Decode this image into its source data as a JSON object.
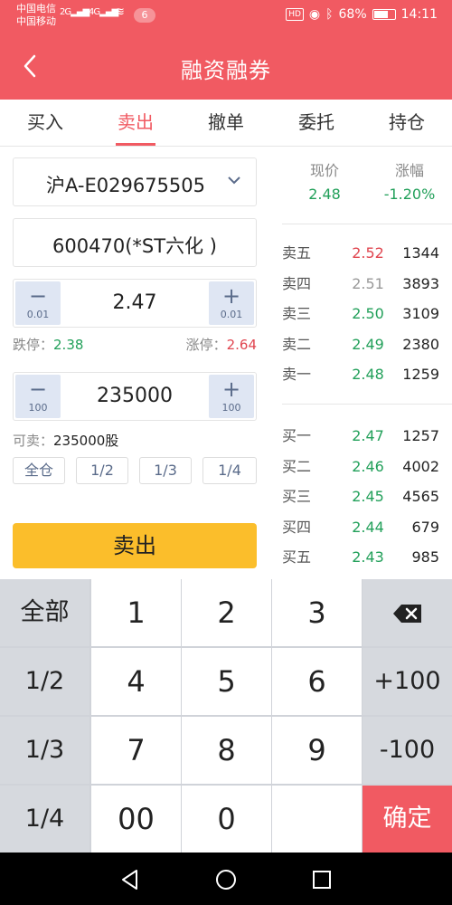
{
  "status_bar": {
    "carrier_1": "中国电信",
    "carrier_2": "中国移动",
    "signal_1": "2G",
    "signal_2": "4G",
    "notification_count": "6",
    "hd": "HD",
    "battery": "68%",
    "battery_level": 0.68,
    "time": "14:11"
  },
  "header": {
    "title": "融资融券"
  },
  "tabs": [
    {
      "label": "买入"
    },
    {
      "label": "卖出"
    },
    {
      "label": "撤单"
    },
    {
      "label": "委托"
    },
    {
      "label": "持仓"
    }
  ],
  "active_tab": "卖出",
  "form": {
    "account": "沪A-E029675505",
    "stock": "600470(*ST六化 )",
    "price": "2.47",
    "price_step_minus": "0.01",
    "price_step_plus": "0.01",
    "limit_down_label": "跌停：",
    "limit_down": "2.38",
    "limit_up_label": "涨停：",
    "limit_up": "2.64",
    "quantity": "235000",
    "qty_step_minus": "100",
    "qty_step_plus": "100",
    "sellable_label": "可卖：",
    "sellable_value": "235000股",
    "ratios": [
      "全仓",
      "1/2",
      "1/3",
      "1/4"
    ],
    "sell_button": "卖出"
  },
  "quote": {
    "price_label": "现价",
    "price": "2.48",
    "change_label": "涨幅",
    "change": "-1.20%"
  },
  "order_book": {
    "asks": [
      {
        "label": "卖五",
        "price": "2.52",
        "volume": "1344",
        "color": "#e0454f"
      },
      {
        "label": "卖四",
        "price": "2.51",
        "volume": "3893",
        "color": "#999999"
      },
      {
        "label": "卖三",
        "price": "2.50",
        "volume": "3109",
        "color": "#22a05a"
      },
      {
        "label": "卖二",
        "price": "2.49",
        "volume": "2380",
        "color": "#22a05a"
      },
      {
        "label": "卖一",
        "price": "2.48",
        "volume": "1259",
        "color": "#22a05a"
      }
    ],
    "bids": [
      {
        "label": "买一",
        "price": "2.47",
        "volume": "1257",
        "color": "#22a05a"
      },
      {
        "label": "买二",
        "price": "2.46",
        "volume": "4002",
        "color": "#22a05a"
      },
      {
        "label": "买三",
        "price": "2.45",
        "volume": "4565",
        "color": "#22a05a"
      },
      {
        "label": "买四",
        "price": "2.44",
        "volume": "679",
        "color": "#22a05a"
      },
      {
        "label": "买五",
        "price": "2.43",
        "volume": "985",
        "color": "#22a05a"
      }
    ]
  },
  "keypad": {
    "side_keys": [
      "全部",
      "1/2",
      "1/3",
      "1/4"
    ],
    "digits": [
      "1",
      "2",
      "3",
      "4",
      "5",
      "6",
      "7",
      "8",
      "9",
      "00",
      "0"
    ],
    "plus_100": "+100",
    "minus_100": "-100",
    "confirm": "确定"
  },
  "colors": {
    "brand_red": "#f15a62",
    "rise_red": "#e0454f",
    "fall_green": "#22a05a",
    "sell_yellow": "#fbbe2b"
  }
}
